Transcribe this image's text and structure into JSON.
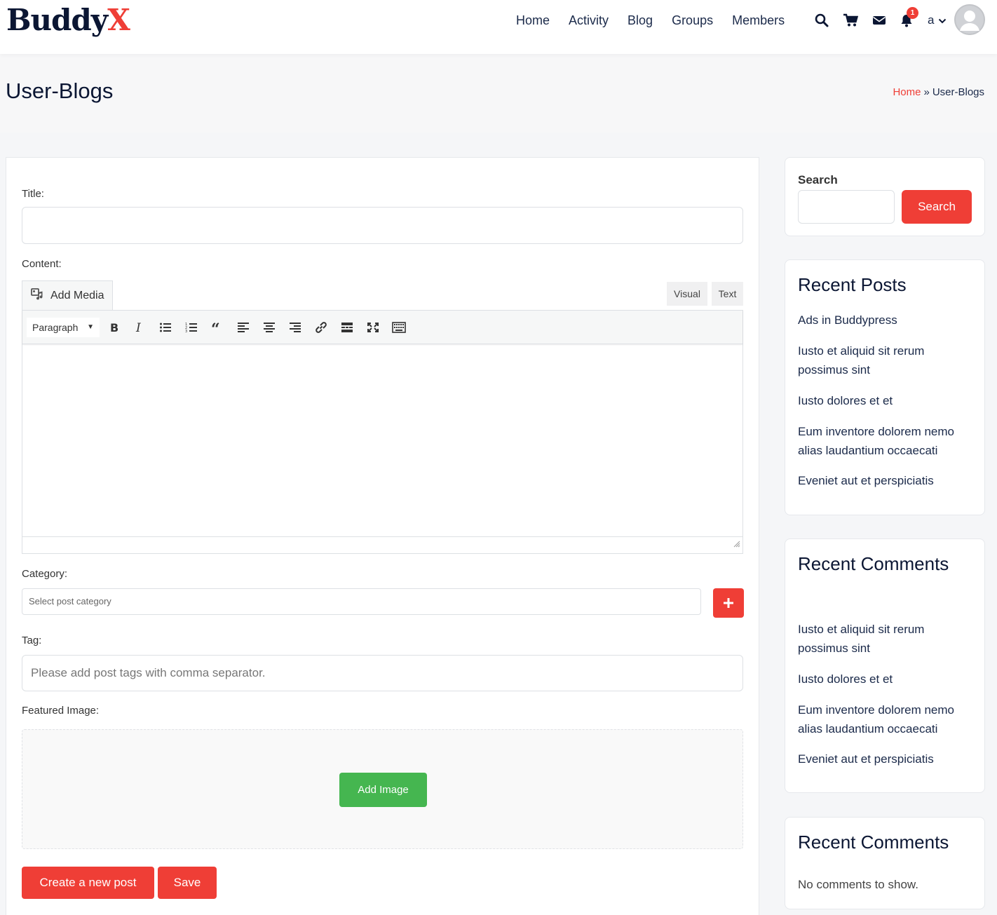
{
  "site": {
    "logo_main": "Buddy",
    "logo_accent": "X"
  },
  "nav": {
    "items": [
      "Home",
      "Activity",
      "Blog",
      "Groups",
      "Members"
    ]
  },
  "header": {
    "icons": [
      "search-icon",
      "cart-icon",
      "envelope-icon",
      "bell-icon"
    ],
    "notification_count": "1",
    "user_initial": "a"
  },
  "page": {
    "title": "User-Blogs"
  },
  "breadcrumb": {
    "home": "Home",
    "separator": "»",
    "current": "User-Blogs"
  },
  "form": {
    "title_label": "Title:",
    "content_label": "Content:",
    "add_media": "Add Media",
    "tab_visual": "Visual",
    "tab_text": "Text",
    "format_select": "Paragraph",
    "toolbar_icons": [
      "bold-icon",
      "italic-icon",
      "bullet-list-icon",
      "numbered-list-icon",
      "blockquote-icon",
      "align-left-icon",
      "align-center-icon",
      "align-right-icon",
      "link-icon",
      "read-more-icon",
      "fullscreen-icon",
      "toolbar-toggle-icon"
    ],
    "category_label": "Category:",
    "category_placeholder": "Select post category",
    "tag_label": "Tag:",
    "tag_placeholder": "Please add post tags with comma separator.",
    "featured_label": "Featured Image:",
    "add_image": "Add Image",
    "create_button": "Create a new post",
    "save_button": "Save"
  },
  "sidebar": {
    "search": {
      "label": "Search",
      "button": "Search"
    },
    "recent_posts": {
      "title": "Recent Posts",
      "items": [
        "Ads in Buddypress",
        "Iusto et aliquid sit rerum possimus sint",
        "Iusto dolores et et",
        "Eum inventore dolorem nemo alias laudantium occaecati",
        "Eveniet aut et perspiciatis"
      ]
    },
    "recent_comments_1": {
      "title": "Recent Comments",
      "items": [
        "Iusto et aliquid sit rerum possimus sint",
        "Iusto dolores et et",
        "Eum inventore dolorem nemo alias laudantium occaecati",
        "Eveniet aut et perspiciatis"
      ]
    },
    "recent_comments_2": {
      "title": "Recent Comments",
      "empty": "No comments to show."
    }
  },
  "colors": {
    "accent": "#ef3e36",
    "success": "#45b650",
    "heading": "#0b1633"
  }
}
